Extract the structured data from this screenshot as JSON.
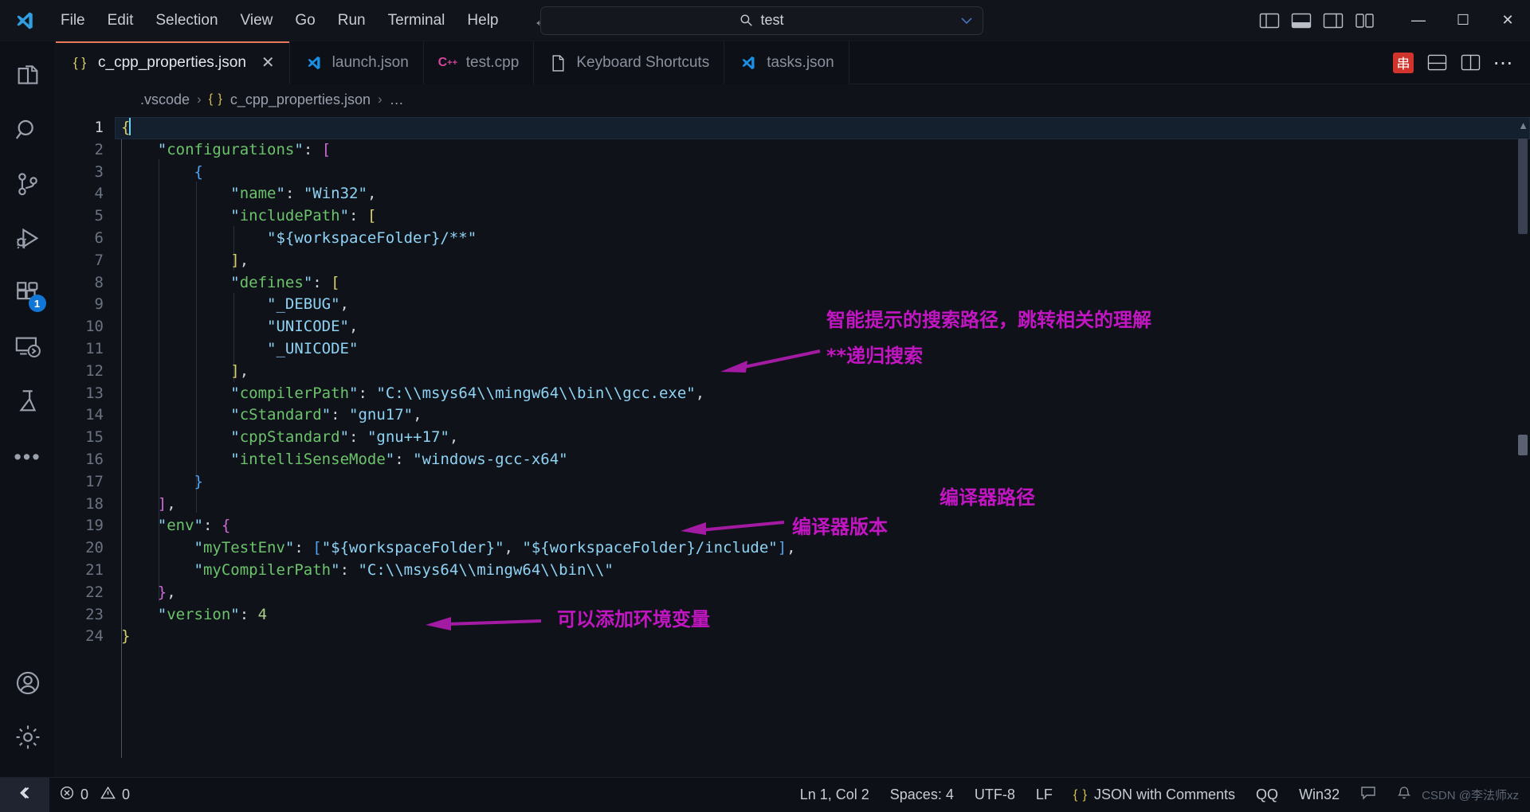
{
  "titlebar": {
    "logo_icon": "vscode-logo-icon",
    "menus": [
      "File",
      "Edit",
      "Selection",
      "View",
      "Go",
      "Run",
      "Terminal",
      "Help"
    ],
    "nav_back_icon": "arrow-left-icon",
    "nav_forward_icon": "arrow-right-icon",
    "quick_input": {
      "value": "test",
      "search_icon": "search-icon",
      "chevron_icon": "chevron-down-icon"
    },
    "layout_icons": [
      "layout-sidebar-left-icon",
      "layout-panel-icon",
      "layout-sidebar-right-icon",
      "customize-layout-icon"
    ],
    "window_controls": {
      "minimize": "—",
      "maximize": "☐",
      "close": "✕"
    }
  },
  "activitybar": {
    "items": [
      {
        "name": "explorer",
        "icon": "files-icon",
        "badge": ""
      },
      {
        "name": "search",
        "icon": "search-icon",
        "badge": ""
      },
      {
        "name": "source-control",
        "icon": "source-control-icon",
        "badge": ""
      },
      {
        "name": "run-and-debug",
        "icon": "run-debug-icon",
        "badge": ""
      },
      {
        "name": "extensions",
        "icon": "extensions-icon",
        "badge": "1"
      },
      {
        "name": "remote-explorer",
        "icon": "remote-explorer-icon",
        "badge": ""
      },
      {
        "name": "testing",
        "icon": "beaker-icon",
        "badge": ""
      },
      {
        "name": "more-views",
        "icon": "ellipsis-icon",
        "badge": ""
      }
    ],
    "bottom_items": [
      {
        "name": "accounts",
        "icon": "account-icon"
      },
      {
        "name": "settings",
        "icon": "gear-icon"
      }
    ]
  },
  "tabs": [
    {
      "label": "c_cpp_properties.json",
      "icon": "json-braces-icon",
      "active": true,
      "closable": true
    },
    {
      "label": "launch.json",
      "icon": "vscode-logo-icon",
      "active": false,
      "closable": false
    },
    {
      "label": "test.cpp",
      "icon": "cpp-icon",
      "active": false,
      "closable": false
    },
    {
      "label": "Keyboard Shortcuts",
      "icon": "file-icon",
      "active": false,
      "closable": false
    },
    {
      "label": "tasks.json",
      "icon": "vscode-logo-icon",
      "active": false,
      "closable": false
    }
  ],
  "tab_actions": [
    {
      "name": "chinese-ime-indicator",
      "icon": "ime-icon",
      "label": "串"
    },
    {
      "name": "split-editor-down",
      "icon": "split-down-icon"
    },
    {
      "name": "split-editor-right",
      "icon": "split-right-icon"
    },
    {
      "name": "more-actions",
      "icon": "ellipsis-icon"
    }
  ],
  "breadcrumb": {
    "folder": ".vscode",
    "file_icon": "json-braces-icon",
    "file": "c_cpp_properties.json",
    "tail": "…",
    "separator": "›"
  },
  "editor": {
    "lines": [
      {
        "n": 1,
        "text": "{"
      },
      {
        "n": 2,
        "text": "    \"configurations\": ["
      },
      {
        "n": 3,
        "text": "        {"
      },
      {
        "n": 4,
        "text": "            \"name\": \"Win32\","
      },
      {
        "n": 5,
        "text": "            \"includePath\": ["
      },
      {
        "n": 6,
        "text": "                \"${workspaceFolder}/**\""
      },
      {
        "n": 7,
        "text": "            ],"
      },
      {
        "n": 8,
        "text": "            \"defines\": ["
      },
      {
        "n": 9,
        "text": "                \"_DEBUG\","
      },
      {
        "n": 10,
        "text": "                \"UNICODE\","
      },
      {
        "n": 11,
        "text": "                \"_UNICODE\""
      },
      {
        "n": 12,
        "text": "            ],"
      },
      {
        "n": 13,
        "text": "            \"compilerPath\": \"C:\\\\msys64\\\\mingw64\\\\bin\\\\gcc.exe\","
      },
      {
        "n": 14,
        "text": "            \"cStandard\": \"gnu17\","
      },
      {
        "n": 15,
        "text": "            \"cppStandard\": \"gnu++17\","
      },
      {
        "n": 16,
        "text": "            \"intelliSenseMode\": \"windows-gcc-x64\""
      },
      {
        "n": 17,
        "text": "        }"
      },
      {
        "n": 18,
        "text": "    ],"
      },
      {
        "n": 19,
        "text": "    \"env\": {"
      },
      {
        "n": 20,
        "text": "        \"myTestEnv\": [\"${workspaceFolder}\", \"${workspaceFolder}/include\"],"
      },
      {
        "n": 21,
        "text": "        \"myCompilerPath\": \"C:\\\\msys64\\\\mingw64\\\\bin\\\\\""
      },
      {
        "n": 22,
        "text": "    },"
      },
      {
        "n": 23,
        "text": "    \"version\": 4"
      },
      {
        "n": 24,
        "text": "}"
      }
    ],
    "cursor_line": 1,
    "annotations": [
      {
        "id": "ann-includepath-1",
        "text": "智能提示的搜索路径，跳转相关的理解"
      },
      {
        "id": "ann-includepath-2",
        "text": "**递归搜索"
      },
      {
        "id": "ann-compilerpath",
        "text": "编译器路径"
      },
      {
        "id": "ann-cstandard",
        "text": "编译器版本"
      },
      {
        "id": "ann-env",
        "text": "可以添加环境变量"
      }
    ]
  },
  "statusbar": {
    "remote_icon": "remote-window-icon",
    "errors_icon": "error-circle-icon",
    "errors": "0",
    "warnings_icon": "warning-triangle-icon",
    "warnings": "0",
    "cursor_position": "Ln 1, Col 2",
    "indentation": "Spaces: 4",
    "encoding": "UTF-8",
    "eol": "LF",
    "language_icon": "json-braces-icon",
    "language": "JSON with Comments",
    "ime": "QQ",
    "platform": "Win32",
    "bell_icon": "bell-icon",
    "feedback_icon": "feedback-icon",
    "watermark": "CSDN @李法师xz"
  },
  "colors": {
    "accent": "#1177d6",
    "active_tab_border": "#e8795a",
    "annotation": "#c216c2",
    "json_key": "#6cc36c",
    "json_string": "#8fd3f4",
    "background": "#0f1219"
  }
}
